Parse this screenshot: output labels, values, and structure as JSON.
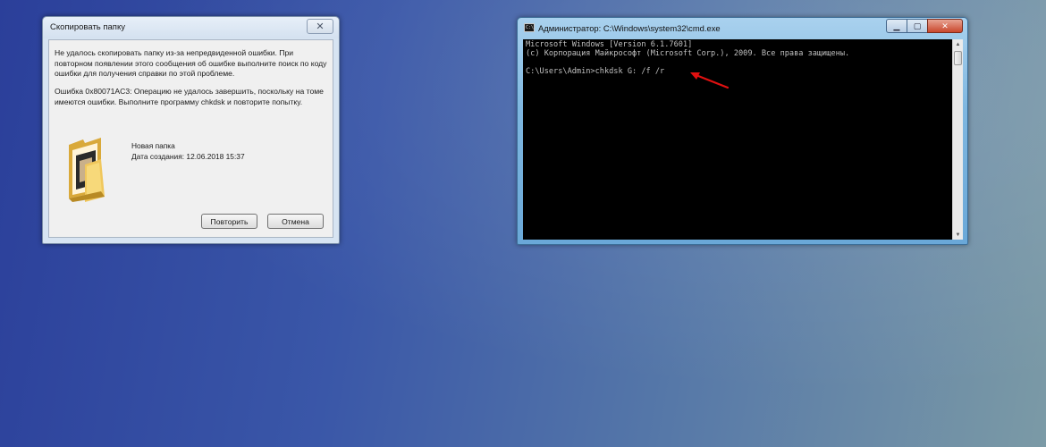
{
  "copy_dialog": {
    "title": "Скопировать папку",
    "close_symbol": "✕",
    "message1": "Не удалось скопировать папку из-за непредвиденной ошибки. При повторном появлении этого сообщения об ошибке выполните поиск по коду ошибки для получения справки по этой проблеме.",
    "message2": "Ошибка 0x80071AC3: Операцию не удалось завершить, поскольку на томе имеются ошибки. Выполните программу chkdsk и повторите попытку.",
    "folder_icon": "folder-icon",
    "folder_name": "Новая папка",
    "folder_date": "Дата создания: 12.06.2018 15:37",
    "retry_label": "Повторить",
    "cancel_label": "Отмена"
  },
  "cmd_window": {
    "title": "Администратор: C:\\Windows\\system32\\cmd.exe",
    "icon_text": "C:\\",
    "minimize_symbol": "▁",
    "maximize_symbol": "▢",
    "close_symbol": "✕",
    "lines": [
      "Microsoft Windows [Version 6.1.7601]",
      "(c) Корпорация Майкрософт (Microsoft Corp.), 2009. Все права защищены.",
      "C:\\Users\\Admin>chkdsk G: /f /r"
    ],
    "scroll_up_symbol": "▲",
    "scroll_down_symbol": "▼"
  },
  "annotation": {
    "arrow_color": "#e01010"
  }
}
